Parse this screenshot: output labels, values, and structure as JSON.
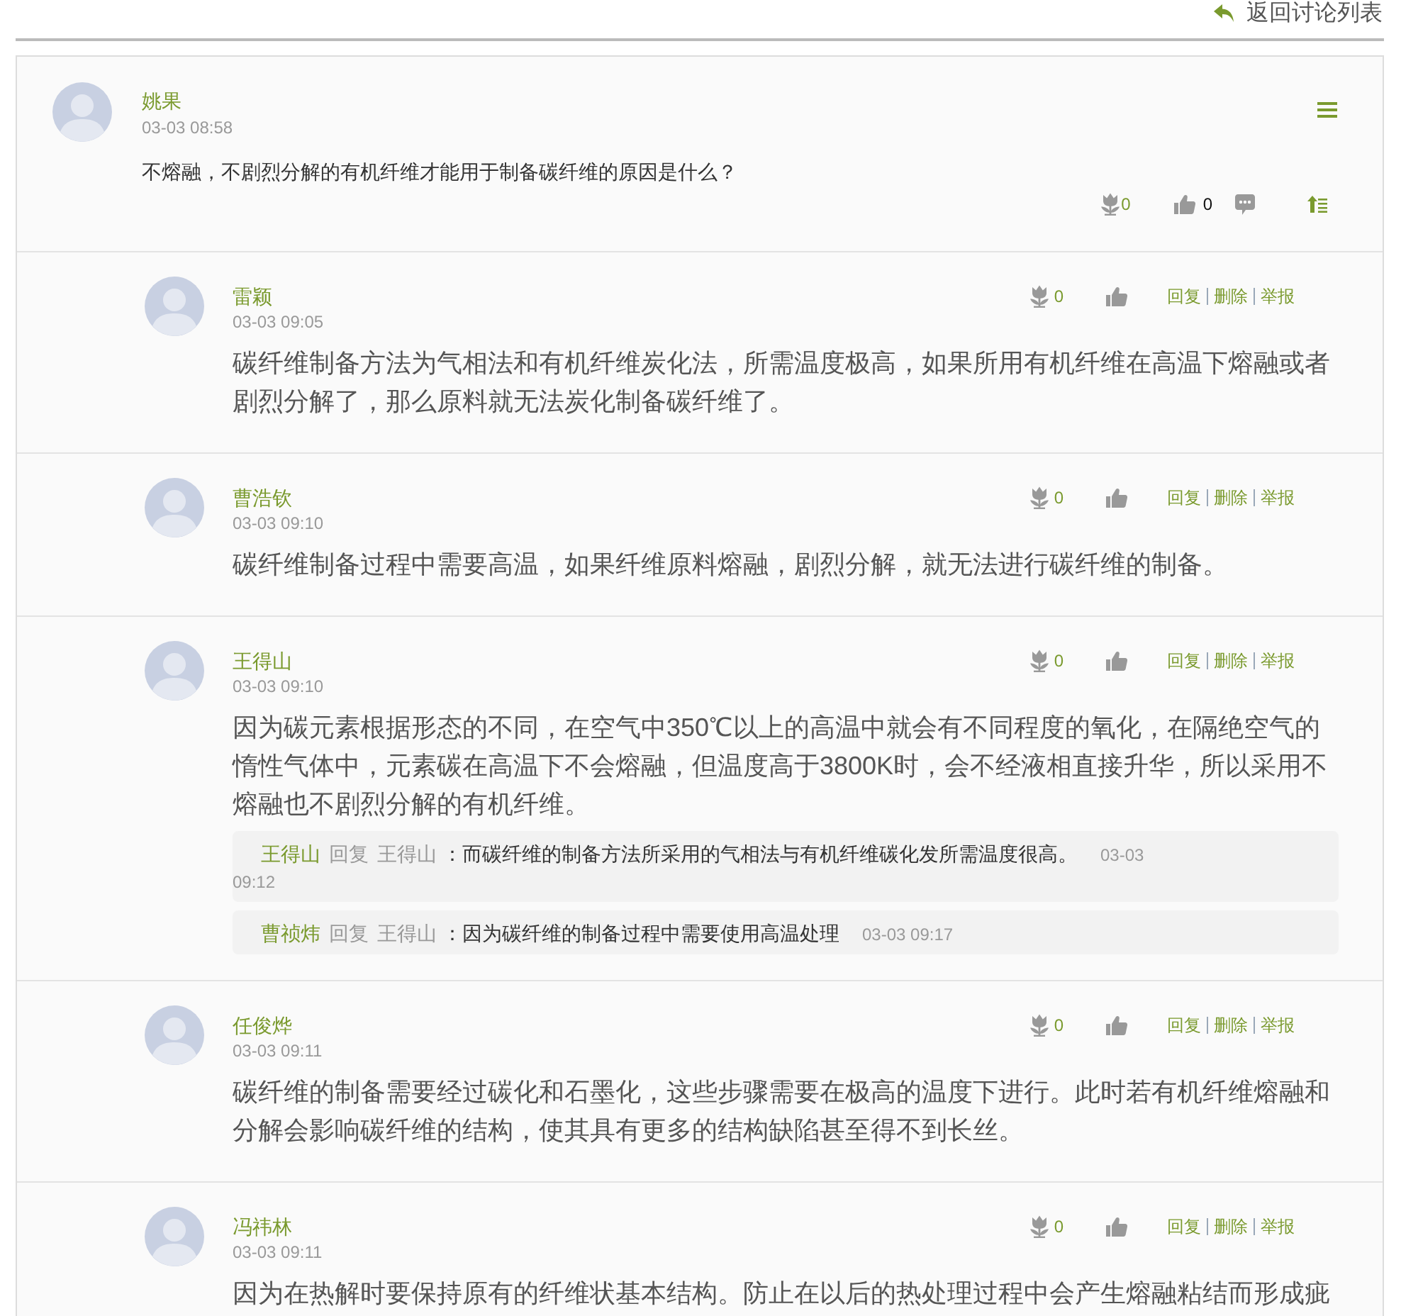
{
  "back_link": {
    "label": "返回讨论列表"
  },
  "question": {
    "author": "姚果",
    "time": "03-03 08:58",
    "text": "不熔融，不剧烈分解的有机纤维才能用于制备碳纤维的原因是什么？",
    "flower_count": "0",
    "like_count": "0"
  },
  "replies": [
    {
      "author": "雷颖",
      "time": "03-03 09:05",
      "flower_count": "0",
      "actions": [
        "回复",
        "删除",
        "举报"
      ],
      "text": "碳纤维制备方法为气相法和有机纤维炭化法，所需温度极高，如果所用有机纤维在高温下熔融或者剧烈分解了，那么原料就无法炭化制备碳纤维了。"
    },
    {
      "author": "曹浩钦",
      "time": "03-03 09:10",
      "flower_count": "0",
      "actions": [
        "回复",
        "删除",
        "举报"
      ],
      "text": "碳纤维制备过程中需要高温，如果纤维原料熔融，剧烈分解，就无法进行碳纤维的制备。"
    },
    {
      "author": "王得山",
      "time": "03-03 09:10",
      "flower_count": "0",
      "actions": [
        "回复",
        "删除",
        "举报"
      ],
      "text": "因为碳元素根据形态的不同，在空气中350℃以上的高温中就会有不同程度的氧化，在隔绝空气的惰性气体中，元素碳在高温下不会熔融，但温度高于3800K时，会不经液相直接升华，所以采用不熔融也不剧烈分解的有机纤维。",
      "sub_replies": [
        {
          "author": "王得山",
          "verb": "回复",
          "target": "王得山",
          "text": "：而碳纤维的制备方法所采用的气相法与有机纤维碳化发所需温度很高。",
          "time": "03-03 09:12"
        },
        {
          "author": "曹祯炜",
          "verb": "回复",
          "target": "王得山",
          "text": "：因为碳纤维的制备过程中需要使用高温处理",
          "time": "03-03 09:17"
        }
      ]
    },
    {
      "author": "任俊烨",
      "time": "03-03 09:11",
      "flower_count": "0",
      "actions": [
        "回复",
        "删除",
        "举报"
      ],
      "text": "碳纤维的制备需要经过碳化和石墨化，这些步骤需要在极高的温度下进行。此时若有机纤维熔融和分解会影响碳纤维的结构，使其具有更多的结构缺陷甚至得不到长丝。"
    },
    {
      "author": "冯祎林",
      "time": "03-03 09:11",
      "flower_count": "0",
      "actions": [
        "回复",
        "删除",
        "举报"
      ],
      "text": "因为在热解时要保持原有的纤维状基本结构。防止在以后的热处理过程中会产生熔融粘结而形成疵"
    }
  ]
}
